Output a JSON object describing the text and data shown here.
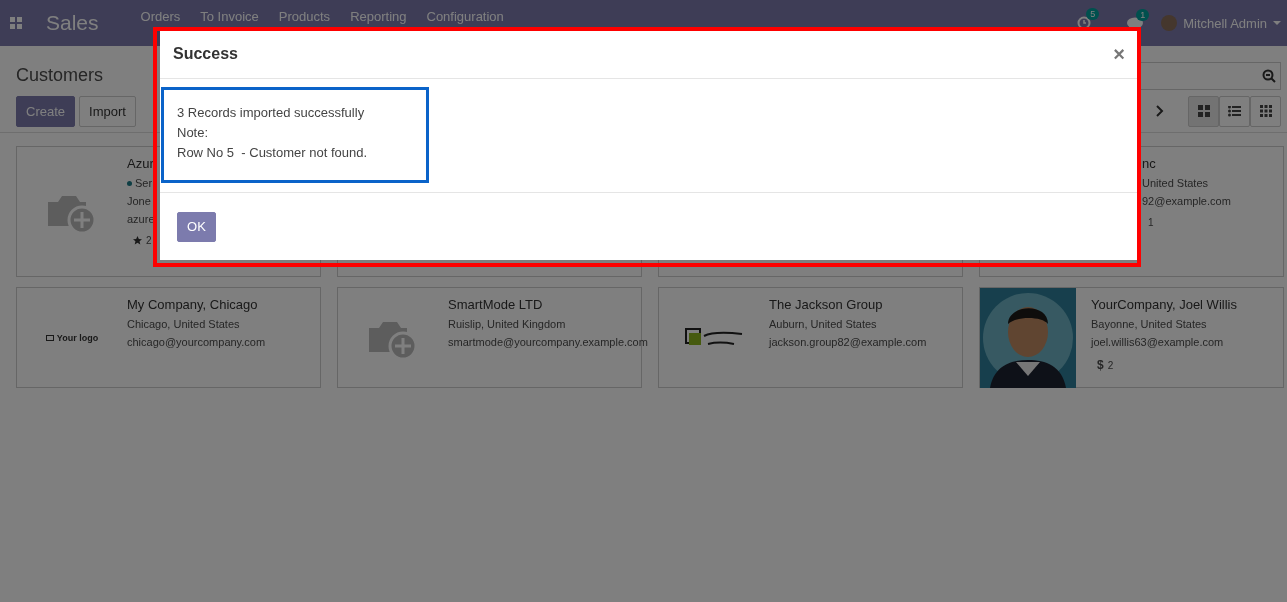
{
  "navbar": {
    "app_name": "Sales",
    "menu": [
      "Orders",
      "To Invoice",
      "Products",
      "Reporting",
      "Configuration"
    ],
    "activity_count": "5",
    "message_count": "1",
    "user": "Mitchell Admin"
  },
  "control_panel": {
    "title": "Customers",
    "buttons": [
      "Create",
      "Import"
    ],
    "views": [
      {
        "kind": "kanban",
        "selected": true
      },
      {
        "kind": "list",
        "selected": false
      },
      {
        "kind": "grid",
        "selected": false
      }
    ]
  },
  "customers": [
    {
      "kind": "camera",
      "name": "Azur",
      "tag": {
        "label": "Ser",
        "color": "#0e3e44"
      },
      "lines": [
        "Jone",
        "azure"
      ],
      "footer": {
        "kind": "star",
        "count": "2"
      }
    },
    {
      "kind": "covered"
    },
    {
      "kind": "covered"
    },
    {
      "kind": "partial",
      "name": "nc",
      "lines": [
        "United States",
        "92@example.com"
      ],
      "footer": {
        "kind": "plain",
        "count": "1"
      }
    },
    {
      "kind": "logo",
      "logo": "Your logo",
      "name": "My Company, Chicago",
      "lines": [
        "Chicago, United States",
        "chicago@yourcompany.com"
      ]
    },
    {
      "kind": "camera",
      "name": "SmartMode LTD",
      "lines": [
        "Ruislip, United Kingdom",
        "smartmode@yourcompany.example.com"
      ]
    },
    {
      "kind": "emblem",
      "name": "The Jackson Group",
      "lines": [
        "Auburn, United States",
        "jackson.group82@example.com"
      ]
    },
    {
      "name": "YourCompany, Joel Willis",
      "lines": [
        "Bayonne, United States",
        "joel.willis63@example.com"
      ],
      "footer": {
        "kind": "dollar",
        "symbol": "$",
        "count": "2"
      }
    }
  ],
  "dialog": {
    "title": "Success",
    "close": "×",
    "lines": [
      "3 Records imported successfully",
      "Note:",
      "Row No 5  - Customer not found."
    ],
    "ok": "OK"
  }
}
